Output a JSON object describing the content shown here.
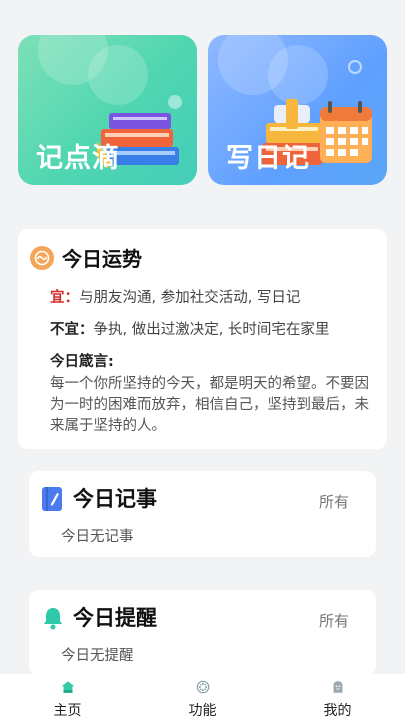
{
  "tiles": [
    {
      "label": "记点滴"
    },
    {
      "label": "写日记"
    }
  ],
  "fortune": {
    "title": "今日运势",
    "good_key": "宜",
    "good_text": "与朋友沟通, 参加社交活动, 写日记",
    "bad_key": "不宜",
    "bad_text": "争执, 做出过激决定, 长时间宅在家里",
    "motto_label": "今日箴言:",
    "motto_text": "每一个你所坚持的今天，都是明天的希望。不要因为一时的困难而放弃，相信自己，坚持到最后，未来属于坚持的人。"
  },
  "notes": {
    "title": "今日记事",
    "all_label": "所有",
    "empty_text": "今日无记事"
  },
  "reminders": {
    "title": "今日提醒",
    "all_label": "所有",
    "empty_text": "今日无提醒"
  },
  "tabbar": {
    "items": [
      {
        "label": "主页",
        "icon": "home-icon"
      },
      {
        "label": "功能",
        "icon": "function-icon"
      },
      {
        "label": "我的",
        "icon": "profile-icon"
      }
    ]
  },
  "colors": {
    "tile_green": "#4fd6b0",
    "tile_blue": "#5fa0ff",
    "accent_teal": "#2fc9a9",
    "fortune_icon": "#f4a55a",
    "good_key": "#d52b2b"
  }
}
